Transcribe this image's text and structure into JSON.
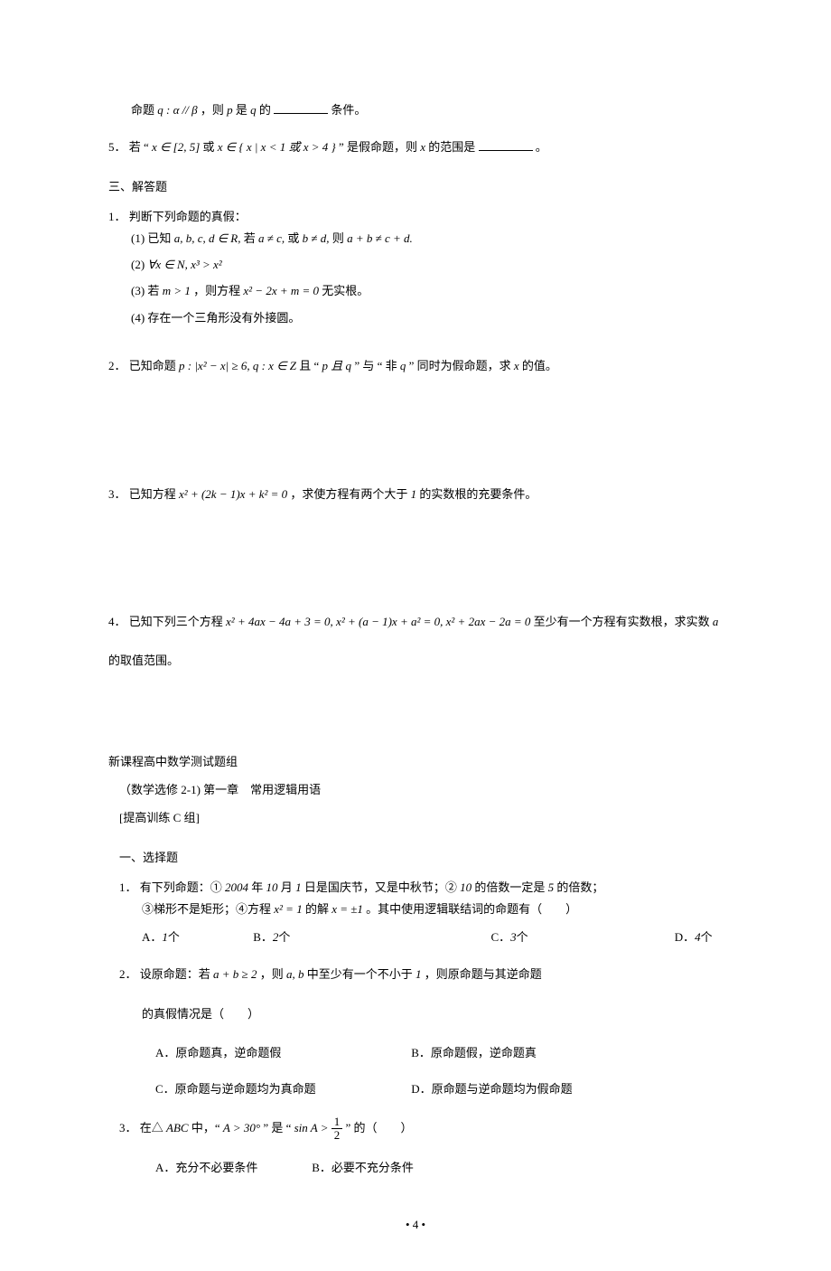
{
  "top": {
    "line4_pre": "命题",
    "line4_math": "q : α // β",
    "line4_mid": "，则 ",
    "line4_math2": "p",
    "line4_mid2": "是",
    "line4_math3": "q",
    "line4_after": " 的",
    "line4_end": " 条件。",
    "q5_num": "5．",
    "q5_pre": "若 “ ",
    "q5_math1": "x ∈ [2, 5]",
    "q5_or": " 或 ",
    "q5_math2": "x ∈ { x | x < 1 或 x > 4 }",
    "q5_mid": " ” 是假命题，则 ",
    "q5_math3": "x",
    "q5_after": " 的范围是",
    "q5_end": "。"
  },
  "section3_title": "三、解答题",
  "s3": {
    "q1_num": "1．",
    "q1_title": "判断下列命题的真假：",
    "q1_1_label": "(1)",
    "q1_1_pre": " 已知",
    "q1_1_math_a": "a, b, c, d ∈ R,",
    "q1_1_pre2": " 若 ",
    "q1_1_math_b": "a ≠ c,",
    "q1_1_or": "或",
    "q1_1_math_c": "b ≠ d,",
    "q1_1_then": "则",
    "q1_1_math_d": "a + b ≠ c + d.",
    "q1_2_label": "(2)",
    "q1_2_math": " ∀x ∈ N, x³ > x²",
    "q1_3_label": "(3)",
    "q1_3_pre": " 若 ",
    "q1_3_math1": "m > 1",
    "q1_3_mid": "，则方程 ",
    "q1_3_math2": "x² − 2x + m = 0",
    "q1_3_end": " 无实根。",
    "q1_4_label": "(4)",
    "q1_4_text": "存在一个三角形没有外接圆。",
    "q2_num": "2．",
    "q2_pre": "已知命题 ",
    "q2_math1": "p : |x² − x| ≥ 6, q : x ∈ Z",
    "q2_mid1": " 且 “ ",
    "q2_math2": "p 且 q",
    "q2_mid2": " ” 与 “ 非 ",
    "q2_math3": "q",
    "q2_mid3": " ” 同时为假命题，求 ",
    "q2_math4": "x",
    "q2_end": " 的值。",
    "q3_num": "3．",
    "q3_pre": "已知方程 ",
    "q3_math": "x² + (2k − 1)x + k² = 0",
    "q3_mid": "，求使方程有两个大于",
    "q3_one": "1",
    "q3_end": "的实数根的充要条件。",
    "q4_num": "4．",
    "q4_pre": "已知下列三个方程  ",
    "q4_math": "x² + 4ax − 4a + 3 = 0, x² + (a − 1)x + a² = 0, x² + 2ax − 2a = 0",
    "q4_mid": " 至少有一个方程有实数根，求实数 ",
    "q4_a": "a",
    "q4_line2": "的取值范围。"
  },
  "set_title": "新课程高中数学测试题组",
  "set_sub1": "（数学选修 2-1) 第一章　常用逻辑用语",
  "set_sub2": "[提高训练 C 组]",
  "sectionA_title": "一、选择题",
  "cA": {
    "q1_num": "1．",
    "q1_line1_a": "有下列命题：①",
    "q1_year": "2004",
    "q1_line1_b": " 年",
    "q1_month": "10",
    "q1_line1_c": " 月",
    "q1_day": "1",
    "q1_line1_d": "日是国庆节，又是中秋节；②",
    "q1_ten": "10",
    "q1_line1_e": " 的倍数一定是 ",
    "q1_five": "5",
    "q1_line1_f": " 的倍数；",
    "q1_line2_a": "③梯形不是矩形；④方程 ",
    "q1_eq": "x² = 1",
    "q1_line2_b": " 的解 ",
    "q1_sol": "x = ±1",
    "q1_line2_c": " 。其中使用逻辑联结词的命题有（　　）",
    "q1_optA": "A．",
    "q1_optA_v": "1",
    "q1_optA_u": " 个",
    "q1_optB": "B．",
    "q1_optB_v": "2",
    "q1_optB_u": " 个",
    "q1_optC": "C．",
    "q1_optC_v": "3",
    "q1_optC_u": " 个",
    "q1_optD": "D．",
    "q1_optD_v": "4",
    "q1_optD_u": " 个",
    "q2_num": "2．",
    "q2_pre": "设原命题：若 ",
    "q2_math1": "a + b ≥ 2",
    "q2_mid1": "，则 ",
    "q2_math2": "a, b",
    "q2_mid2": " 中至少有一个不小于",
    "q2_one": "1",
    "q2_end": "，则原命题与其逆命题",
    "q2_line2": "的真假情况是（　　）",
    "q2_optA": "A．原命题真，逆命题假",
    "q2_optB": "B．原命题假，逆命题真",
    "q2_optC": "C．原命题与逆命题均为真命题",
    "q2_optD": "D．原命题与逆命题均为假命题",
    "q3_num": "3．",
    "q3_pre": "在△",
    "q3_abc": "ABC",
    "q3_mid1": " 中，“ ",
    "q3_math1": "A > 30°",
    "q3_mid2": " ” 是 “ ",
    "q3_sin": "sin A > ",
    "q3_frac_num": "1",
    "q3_frac_den": "2",
    "q3_mid3": " ” 的（　　）",
    "q3_optA": "A．充分不必要条件",
    "q3_optB": "B．必要不充分条件"
  },
  "footer": "• 4 •"
}
